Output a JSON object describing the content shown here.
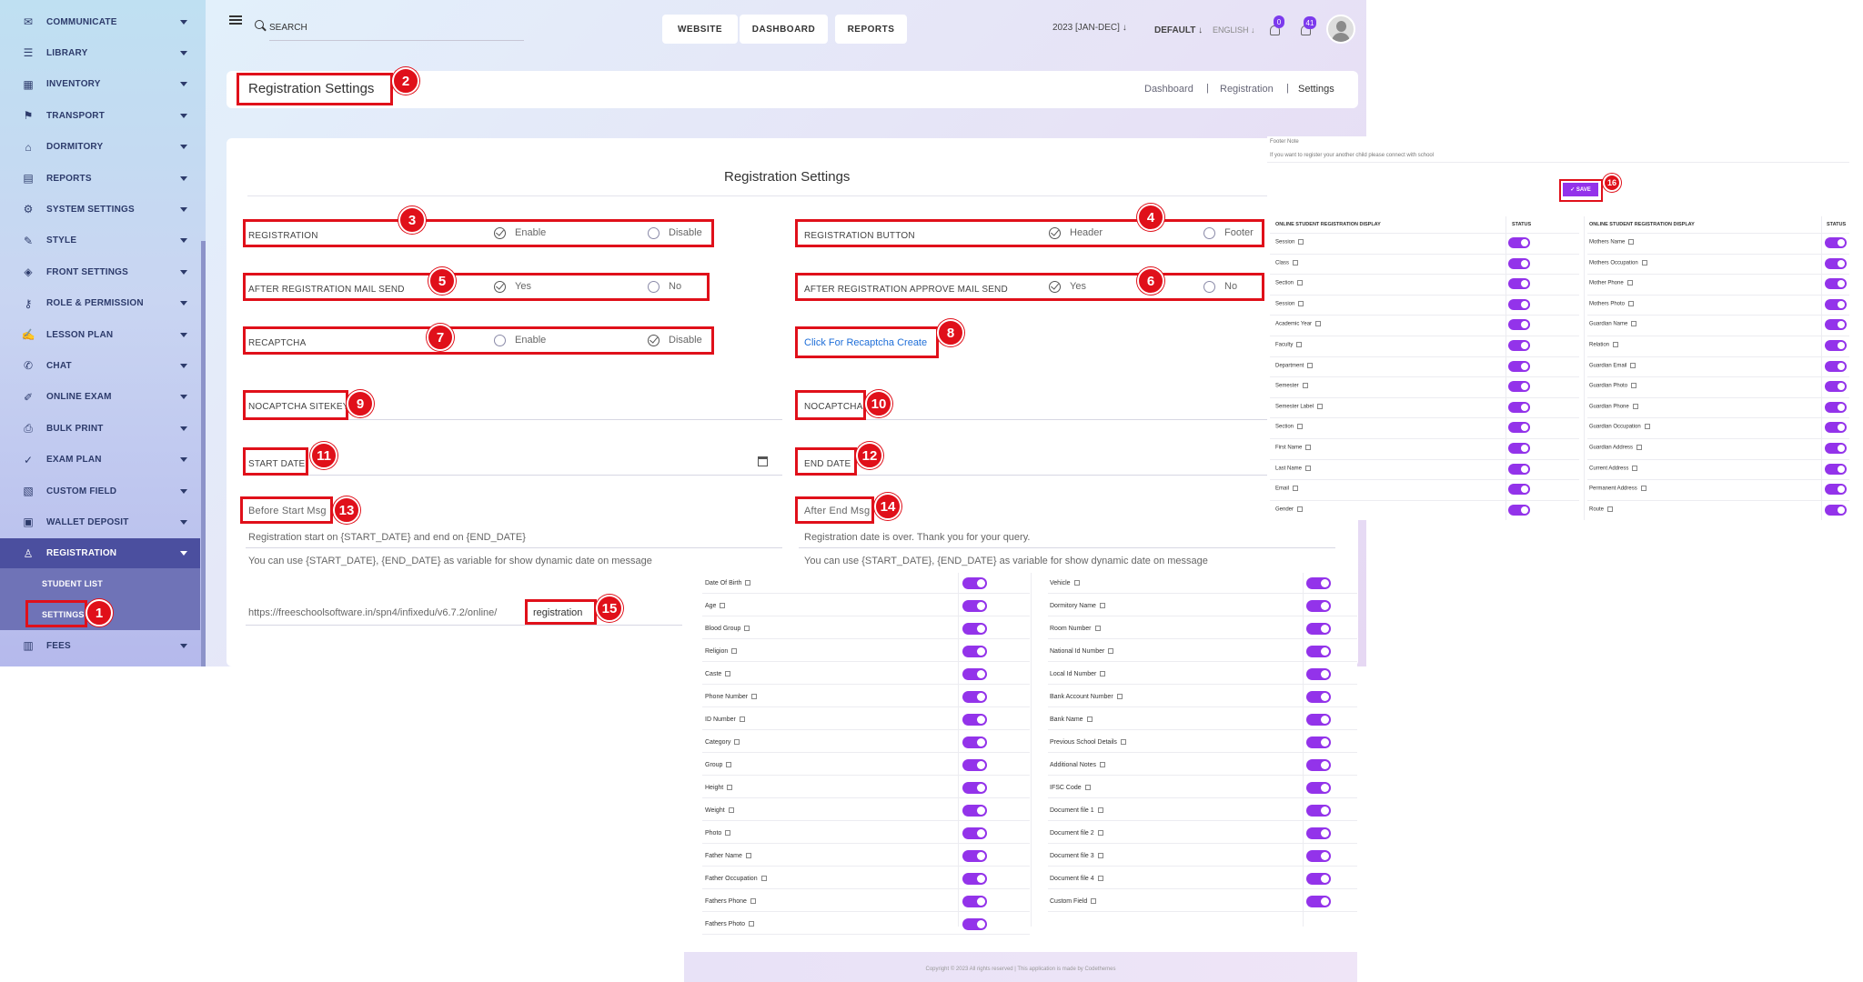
{
  "sidebar": {
    "items": [
      {
        "label": "COMMUNICATE",
        "icon": "communicate-icon"
      },
      {
        "label": "LIBRARY",
        "icon": "library-icon"
      },
      {
        "label": "INVENTORY",
        "icon": "inventory-icon"
      },
      {
        "label": "TRANSPORT",
        "icon": "transport-icon"
      },
      {
        "label": "DORMITORY",
        "icon": "dormitory-icon"
      },
      {
        "label": "REPORTS",
        "icon": "reports-icon"
      },
      {
        "label": "SYSTEM SETTINGS",
        "icon": "system-settings-icon"
      },
      {
        "label": "STYLE",
        "icon": "style-icon"
      },
      {
        "label": "FRONT SETTINGS",
        "icon": "front-settings-icon"
      },
      {
        "label": "ROLE & PERMISSION",
        "icon": "role-permission-icon"
      },
      {
        "label": "LESSON PLAN",
        "icon": "lesson-plan-icon"
      },
      {
        "label": "CHAT",
        "icon": "chat-icon"
      },
      {
        "label": "ONLINE EXAM",
        "icon": "online-exam-icon"
      },
      {
        "label": "BULK PRINT",
        "icon": "bulk-print-icon"
      },
      {
        "label": "EXAM PLAN",
        "icon": "exam-plan-icon"
      },
      {
        "label": "CUSTOM FIELD",
        "icon": "custom-field-icon"
      },
      {
        "label": "WALLET DEPOSIT",
        "icon": "wallet-deposit-icon"
      },
      {
        "label": "REGISTRATION",
        "icon": "registration-icon"
      }
    ],
    "sub_items": [
      "STUDENT LIST",
      "SETTINGS"
    ],
    "fees": {
      "label": "FEES",
      "icon": "fees-icon"
    }
  },
  "header": {
    "search_placeholder": "SEARCH",
    "nav": [
      "WEBSITE",
      "DASHBOARD",
      "REPORTS"
    ],
    "year": "2023 [JAN-DEC]",
    "theme": "DEFAULT",
    "language": "ENGLISH",
    "notification_count": "0",
    "message_count": "41"
  },
  "page": {
    "title": "Registration Settings",
    "breadcrumb": [
      "Dashboard",
      "Registration",
      "Settings"
    ]
  },
  "form": {
    "title": "Registration Settings",
    "registration": {
      "label": "REGISTRATION",
      "opt1": "Enable",
      "opt2": "Disable"
    },
    "registration_button": {
      "label": "REGISTRATION BUTTON",
      "opt1": "Header",
      "opt2": "Footer"
    },
    "after_mail": {
      "label": "AFTER REGISTRATION MAIL SEND",
      "opt1": "Yes",
      "opt2": "No"
    },
    "after_approve_mail": {
      "label": "AFTER REGISTRATION APPROVE MAIL SEND",
      "opt1": "Yes",
      "opt2": "No"
    },
    "recaptcha": {
      "label": "RECAPTCHA",
      "opt1": "Enable",
      "opt2": "Disable"
    },
    "recaptcha_link": "Click For Recaptcha Create",
    "nocaptcha_sitekey": "NOCAPTCHA SITEKEY",
    "nocaptcha": "NOCAPTCHA",
    "start_date": "START DATE",
    "end_date": "END DATE",
    "before_start_msg": "Before Start Msg",
    "after_end_msg": "After End Msg",
    "before_start_value": "Registration start on {START_DATE} and end on {END_DATE}",
    "after_end_value": "Registration date is over. Thank you for your query.",
    "helper": "You can use {START_DATE}, {END_DATE} as variable for show dynamic date on message",
    "url_prefix": "https://freeschoolsoftware.in/spn4/infixedu/v6.7.2/online/",
    "url_slug": "registration"
  },
  "markers": [
    "1",
    "2",
    "3",
    "4",
    "5",
    "6",
    "7",
    "8",
    "9",
    "10",
    "11",
    "12",
    "13",
    "14",
    "15",
    "16"
  ],
  "right_panel": {
    "footer_note_label": "Footer Note",
    "footer_note": "If you want to register your another child please connect with school",
    "save": "✓ SAVE",
    "col_display": "ONLINE STUDENT REGISTRATION DISPLAY",
    "col_status": "STATUS",
    "left_rows": [
      "Session",
      "Class",
      "Section",
      "Session",
      "Academic Year",
      "Faculty",
      "Department",
      "Semester",
      "Semester Label",
      "Section",
      "First Name",
      "Last Name",
      "Email",
      "Gender"
    ],
    "right_rows": [
      "Mothers Name",
      "Mothers Occupation",
      "Mother Phone",
      "Mothers Photo",
      "Guardian Name",
      "Relation",
      "Guardian Email",
      "Guardian Photo",
      "Guardian Phone",
      "Guardian Occupation",
      "Guardian Address",
      "Current Address",
      "Permanent Address",
      "Route"
    ]
  },
  "bottom_panel": {
    "left_rows": [
      "Date Of Birth",
      "Age",
      "Blood Group",
      "Religion",
      "Caste",
      "Phone Number",
      "ID Number",
      "Category",
      "Group",
      "Height",
      "Weight",
      "Photo",
      "Father Name",
      "Father Occupation",
      "Fathers Phone",
      "Fathers Photo"
    ],
    "right_rows": [
      "Vehicle",
      "Dormitory Name",
      "Room Number",
      "National Id Number",
      "Local Id Number",
      "Bank Account Number",
      "Bank Name",
      "Previous School Details",
      "Additional Notes",
      "IFSC Code",
      "Document file 1",
      "Document file 2",
      "Document file 3",
      "Document file 4",
      "Custom Field"
    ],
    "copyright": "Copyright © 2023 All rights reserved | This application is made by Codethemes"
  }
}
